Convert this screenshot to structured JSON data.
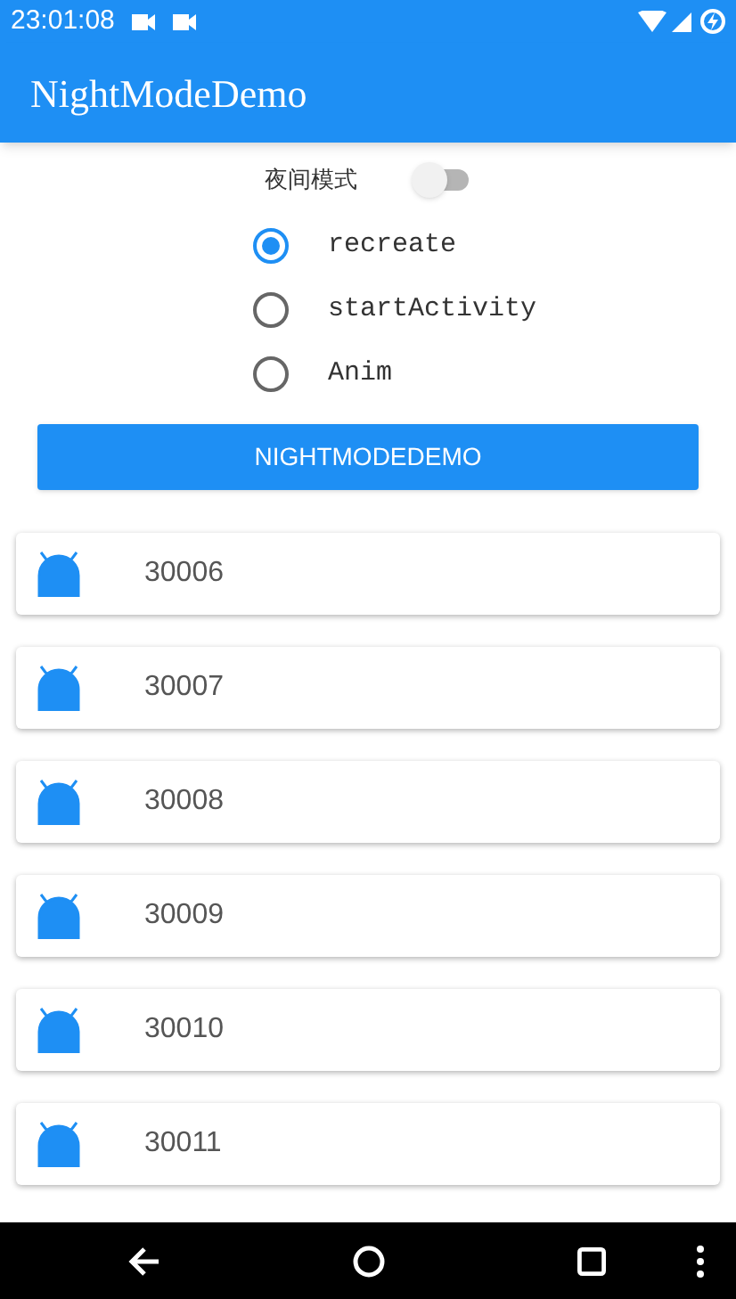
{
  "status_bar": {
    "time": "23:01:08"
  },
  "app_bar": {
    "title": "NightModeDemo"
  },
  "night_mode": {
    "label": "夜间模式",
    "on": false
  },
  "options": [
    {
      "label": "recreate",
      "selected": true
    },
    {
      "label": "startActivity",
      "selected": false
    },
    {
      "label": "Anim",
      "selected": false
    }
  ],
  "button": {
    "label": "NIGHTMODEDEMO"
  },
  "list": [
    {
      "text": "30006"
    },
    {
      "text": "30007"
    },
    {
      "text": "30008"
    },
    {
      "text": "30009"
    },
    {
      "text": "30010"
    },
    {
      "text": "30011"
    }
  ]
}
